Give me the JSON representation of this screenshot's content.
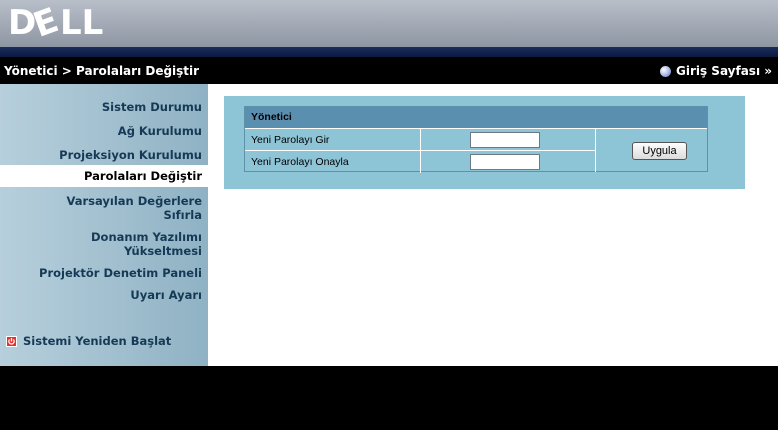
{
  "brand": {
    "logo": "DELL"
  },
  "titlebar": {
    "breadcrumb": "Yönetici > Parolaları Değiştir",
    "home_label": "Giriş Sayfası »"
  },
  "sidebar": {
    "items": [
      {
        "label": "Sistem Durumu"
      },
      {
        "label": "Ağ Kurulumu"
      },
      {
        "label": "Projeksiyon Kurulumu"
      },
      {
        "label": "Parolaları Değiştir"
      },
      {
        "label": "Varsayılan Değerlere Sıfırla"
      },
      {
        "label": "Donanım Yazılımı Yükseltmesi"
      },
      {
        "label": "Projektör Denetim Paneli"
      },
      {
        "label": "Uyarı Ayarı"
      }
    ],
    "restart_label": "Sistemi Yeniden Başlat"
  },
  "form": {
    "header": "Yönetici",
    "new_password_label": "Yeni Parolayı Gir",
    "confirm_password_label": "Yeni Parolayı Onayla",
    "new_password_value": "",
    "confirm_password_value": "",
    "apply_label": "Uygula"
  },
  "colors": {
    "sidebar": "#a9c6d6",
    "panel": "#8ec5d6",
    "table_header": "#5b8fb0",
    "accent_text": "#163a56"
  }
}
